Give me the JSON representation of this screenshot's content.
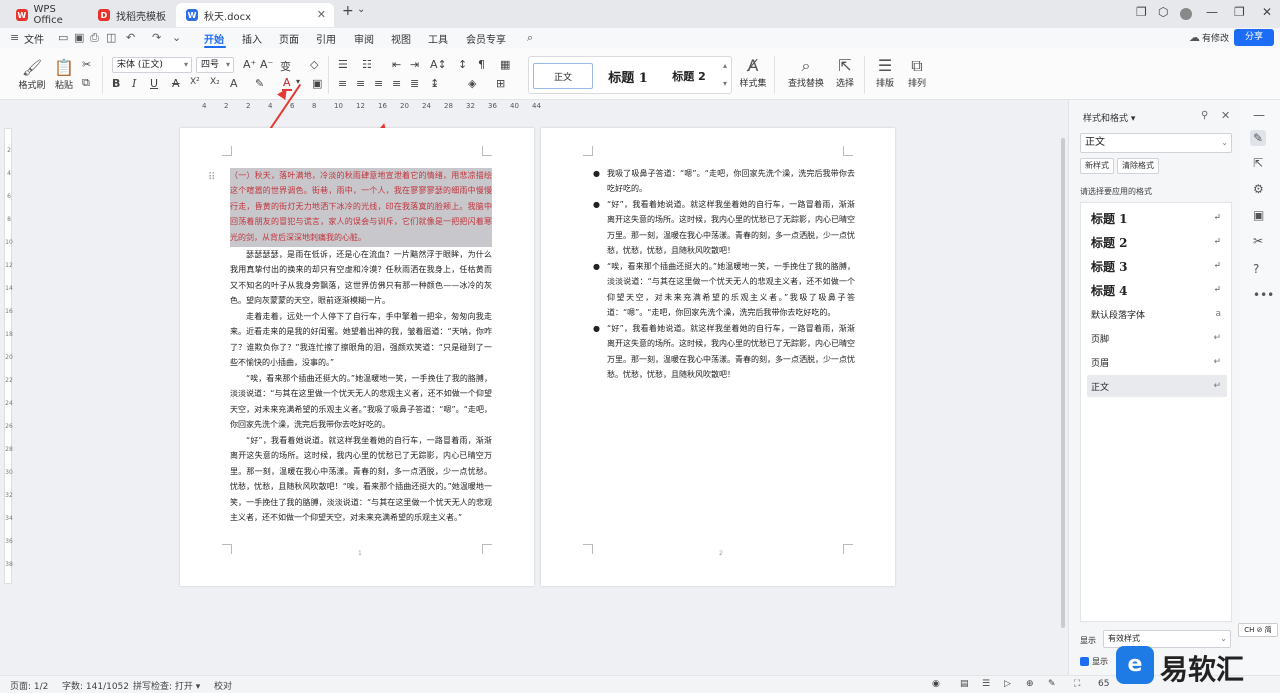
{
  "titlebar": {
    "tabs": [
      {
        "label": "WPS Office"
      },
      {
        "label": "找稻壳模板"
      },
      {
        "label": "秋天.docx"
      }
    ],
    "new_tab": "+",
    "new_tab_dd": "⌄"
  },
  "menubar": {
    "file": "文件",
    "items": [
      "开始",
      "插入",
      "页面",
      "引用",
      "审阅",
      "视图",
      "工具",
      "会员专享"
    ],
    "edit_status": "有修改",
    "share": "分享"
  },
  "ribbon": {
    "format_painter": "格式刷",
    "paste": "粘贴",
    "font_name": "宋体 (正文)",
    "font_size": "四号",
    "style_normal": "正文",
    "style_h1": "标题 1",
    "style_h2": "标题 2",
    "style_set": "样式集",
    "find_replace": "查找替换",
    "select": "选择",
    "layout": "排版",
    "arrange": "排列"
  },
  "ruler": {
    "numbers": [
      "4",
      "2",
      "2",
      "4",
      "6",
      "8",
      "10",
      "12",
      "16",
      "20",
      "24",
      "28",
      "32",
      "36",
      "40",
      "44"
    ]
  },
  "vruler": {
    "numbers": [
      "2",
      "4",
      "6",
      "8",
      "10",
      "12",
      "14",
      "16",
      "18",
      "20",
      "22",
      "24",
      "26",
      "28",
      "30",
      "32",
      "34",
      "36",
      "38"
    ]
  },
  "page1": {
    "paragraphs": [
      "（一）秋天，落叶满地，冷淡的秋雨肆意地宣泄着它的情绪，用悲凉描绘这个喧嚣的世界调色。街巷，雨中，一个人，我在寥寥寥瑟的细雨中慢慢行走，昏黄的街灯无力地洒下冰冷的光线，印在我落寞的脸颊上。我脑中回荡着朋友的冒犯与谎言，家人的误会与训斥，它们就像是一把把闪着寒光的剑，从背后深深地刺痛我的心脏。",
      "瑟瑟瑟瑟，是雨在低诉，还是心在流血？一片黯然浮于眼眸，为什么我用真挚付出的换来的却只有空虚和冷漠？任秋雨洒在我身上，任枯黄而又不知名的叶子从我身旁飘落，这世界仿佛只有那一种颜色——冰冷的灰色。望向灰蒙蒙的天空，眼前逐渐模糊一片。",
      "走着走着，远处一个人停下了自行车，手中擎着一把伞，匆匆向我走来。近看走来的是我的好闺蜜。她望着出神的我，皱着眉道：“天呐，你咋了？谁欺负你了？”我连忙擦了擦眼角的泪，强颜欢笑道：“只是碰到了一些不愉快的小插曲，没事的。”",
      "“唉，看来那个插曲还挺大的。”她温暖地一笑，一手挽住了我的胳膊，淡淡说道：“与其在这里做一个忧天无人的悲观主义者，还不如做一个仰望天空，对未来充满希望的乐观主义者。”我吸了吸鼻子答道：“嗯”。“走吧，你回家先洗个澡，洗完后我带你去吃好吃的。",
      "“好”，我看着她说道。就这样我坐着她的自行车，一路冒着雨，渐渐离开这失意的场所。这时候，我内心里的忧愁已了无踪影，内心已晴空万里。那一刻，温暖在我心中荡漾。青春的刻，多一点洒脱，少一点忧愁。忧愁，忧愁，且随秋风吹散吧！“唉，看来那个插曲还挺大的。”她温暖地一笑，一手挽住了我的胳膊，淡淡说道：“与其在这里做一个忧天无人的悲观主义者，还不如做一个仰望天空，对未来充满希望的乐观主义者。”"
    ],
    "page_number": "1"
  },
  "page2": {
    "bullets": [
      "我吸了吸鼻子答道：“嗯”。“走吧，你回家先洗个澡，洗完后我带你去吃好吃的。",
      "“好”，我看着她说道。就这样我坐着她的自行车，一路冒着雨，渐渐离开这失意的场所。这时候，我内心里的忧愁已了无踪影，内心已晴空万里。那一刻，温暖在我心中荡漾。青春的刻，多一点洒脱，少一点忧愁，忧愁，忧愁，且随秋风吹散吧！",
      "“唉，看来那个插曲还挺大的。”她温暖地一笑，一手挽住了我的胳膊，淡淡说道：“与其在这里做一个忧天无人的悲观主义者，还不如做一个仰望天空，对未来充满希望的乐观主义者。”我吸了吸鼻子答道：“嗯”。“走吧，你回家先洗个澡，洗完后我带你去吃好吃的。",
      "“好”，我看着她说道。就这样我坐着她的自行车，一路冒着雨，渐渐离开这失意的场所。这时候，我内心里的忧愁已了无踪影，内心已晴空万里。那一刻，温暖在我心中荡漾。青春的刻，多一点洒脱，少一点忧愁。忧愁，忧愁，且随秋风吹散吧！"
    ],
    "page_number": "2"
  },
  "panel": {
    "title": "样式和格式",
    "current_style": "正文",
    "new_style": "新样式",
    "clear_format": "清除格式",
    "prompt": "请选择要应用的格式",
    "styles": [
      {
        "label": "标题 1"
      },
      {
        "label": "标题 2"
      },
      {
        "label": "标题 3"
      },
      {
        "label": "标题 4"
      },
      {
        "label": "默认段落字体"
      },
      {
        "label": "页脚"
      },
      {
        "label": "页眉"
      },
      {
        "label": "正文"
      }
    ],
    "display_label": "显示",
    "display_value": "有效样式",
    "display_preview": "显示"
  },
  "ime": "CH ⊘ 简",
  "status": {
    "page": "页面: 1/2",
    "wordcount": "字数: 141/1052",
    "spellcheck": "拼写检查: 打开",
    "proofread": "校对",
    "zoom": "65"
  },
  "watermark": "易软汇"
}
